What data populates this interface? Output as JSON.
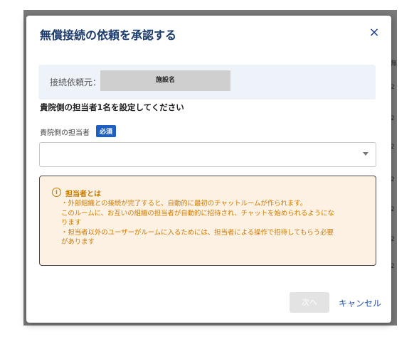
{
  "background": {
    "edge_chars": [
      "無",
      "2",
      "2",
      "2",
      "2",
      "2",
      "2",
      "2"
    ]
  },
  "dialog": {
    "title": "無償接続の依頼を承認する",
    "close_label": "×",
    "source": {
      "label": "接続依頼元：",
      "value": "施設名"
    },
    "set_heading": "貴院側の担当者1名を設定してください",
    "field": {
      "label": "貴院側の担当者",
      "required_badge": "必須",
      "selected_value": ""
    },
    "info": {
      "icon": "i",
      "title": "担当者とは",
      "lines": [
        "・外部組織との接続が完了すると、自動的に最初のチャットルームが作られます。",
        "このルームに、お互いの組織の担当者が自動的に招待され、チャットを始められるようにな",
        "ります",
        "・担当者以外のユーザーがルームに入るためには、担当者による操作で招待してもらう必要",
        "があります"
      ]
    },
    "next_label": "次へ",
    "cancel_label": "キャンセル"
  },
  "colors": {
    "title": "#1a3a6b",
    "accent": "#1f5fc4",
    "info_text": "#d07a00",
    "info_bg": "#fdf1e3"
  }
}
